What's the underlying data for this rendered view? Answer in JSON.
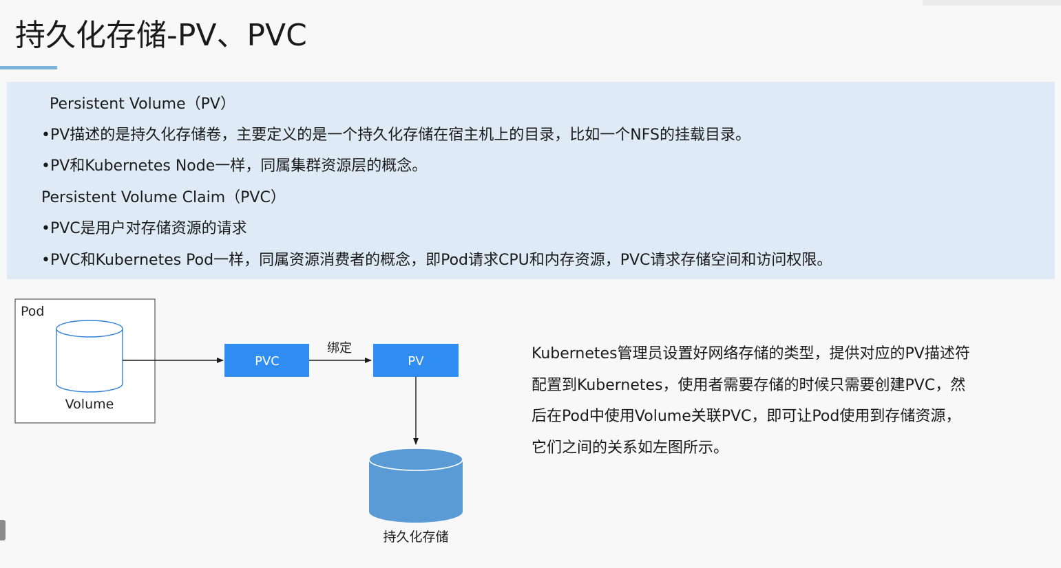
{
  "slide": {
    "title": "持久化存储-PV、PVC"
  },
  "info_box": {
    "lines": [
      "Persistent Volume（PV）",
      "•PV描述的是持久化存储卷，主要定义的是一个持久化存储在宿主机上的目录，比如一个NFS的挂载目录。",
      "•PV和Kubernetes Node一样，同属集群资源层的概念。",
      "Persistent Volume Claim（PVC）",
      "•PVC是用户对存储资源的请求",
      "•PVC和Kubernetes Pod一样，同属资源消费者的概念，即Pod请求CPU和内存资源，PVC请求存储空间和访问权限。"
    ]
  },
  "diagram": {
    "pod_label": "Pod",
    "volume_label": "Volume",
    "pvc_label": "PVC",
    "pv_label": "PV",
    "bind_label": "绑定",
    "storage_label": "持久化存储",
    "colors": {
      "box_blue": "#2f8cf0",
      "storage_blue": "#5b9bd5",
      "line": "#1a1a1a"
    }
  },
  "description": {
    "lines": [
      "Kubernetes管理员设置好网络存储的类型，提供对应的PV描述符",
      "配置到Kubernetes，使用者需要存储的时候只需要创建PVC，然",
      "后在Pod中使用Volume关联PVC，即可让Pod使用到存储资源，",
      "它们之间的关系如左图所示。"
    ]
  }
}
